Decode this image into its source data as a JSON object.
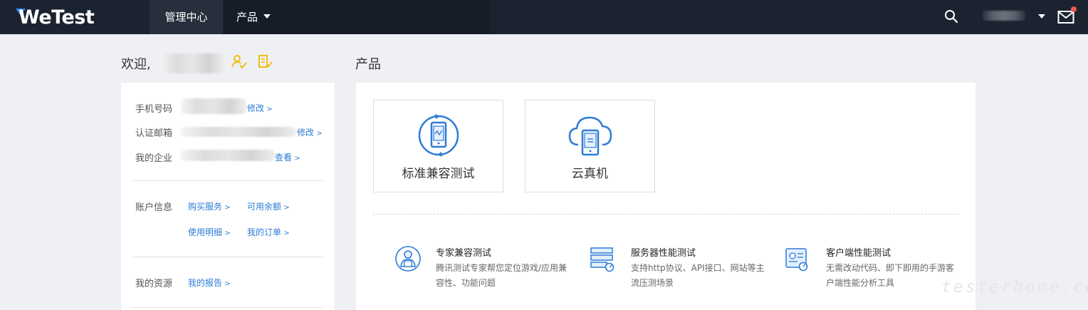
{
  "header": {
    "logo_text": "WeTest",
    "nav": [
      {
        "label": "管理中心"
      },
      {
        "label": "产品"
      }
    ]
  },
  "sidebar": {
    "welcome": "欢迎,",
    "rows": [
      {
        "label": "手机号码",
        "link": "修改"
      },
      {
        "label": "认证邮箱",
        "link": "修改"
      },
      {
        "label": "我的企业",
        "link": "查看"
      }
    ],
    "account": {
      "label": "账户信息",
      "links": [
        "购买服务",
        "可用余额",
        "使用明细",
        "我的订单"
      ]
    },
    "resources": {
      "label": "我的资源",
      "link": "我的报告"
    }
  },
  "products": {
    "title": "产品",
    "tiles": [
      {
        "label": "标准兼容测试",
        "icon": "standard-compat-icon"
      },
      {
        "label": "云真机",
        "icon": "cloud-device-icon"
      }
    ],
    "services": [
      {
        "title": "专家兼容测试",
        "desc": "腾讯测试专家帮您定位游戏/应用兼容性、功能问题",
        "icon": "expert-icon"
      },
      {
        "title": "服务器性能测试",
        "desc": "支持http协议、API接口、网站等主流压测场景",
        "icon": "server-icon"
      },
      {
        "title": "客户端性能测试",
        "desc": "无需改动代码、即下即用的手游客户端性能分析工具",
        "icon": "client-perf-icon"
      }
    ]
  },
  "watermark": "testerhome.com",
  "colors": {
    "topbar": "#1b2330",
    "link": "#2d7bd6",
    "accent": "#f5b900",
    "icon_blue": "#2d7bd6"
  }
}
